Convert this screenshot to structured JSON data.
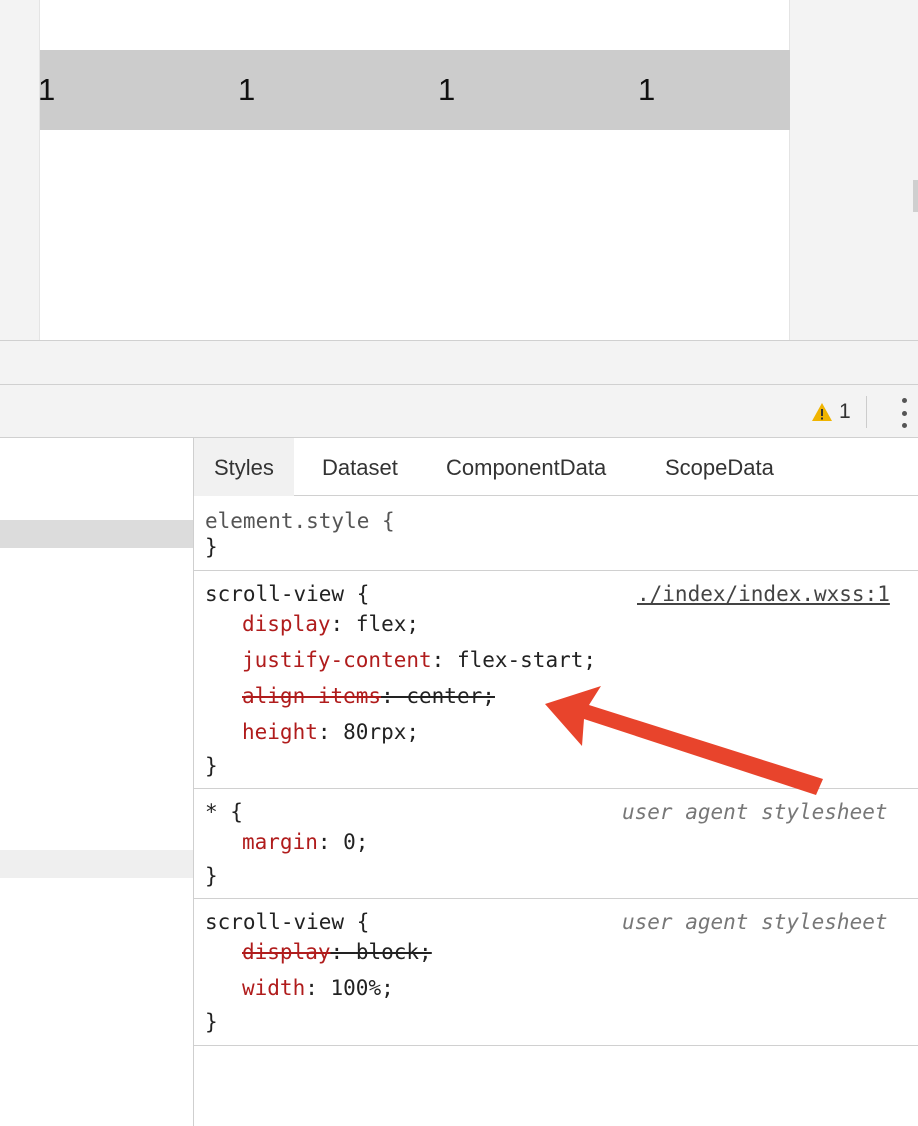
{
  "preview": {
    "row_cells": [
      "1",
      "1",
      "1",
      "1"
    ]
  },
  "toolbar": {
    "warning_count": "1"
  },
  "tabs": [
    {
      "label": "Styles"
    },
    {
      "label": "Dataset"
    },
    {
      "label": "ComponentData"
    },
    {
      "label": "ScopeData"
    }
  ],
  "rules": [
    {
      "selector": "element.style {",
      "close": "}"
    },
    {
      "selector": "scroll-view {",
      "source": "./index/index.wxss:1",
      "decls": [
        {
          "prop": "display",
          "value": "flex;"
        },
        {
          "prop": "justify-content",
          "value": "flex-start;"
        },
        {
          "prop": "align-items",
          "value": "center;"
        },
        {
          "prop": "height",
          "value": "80rpx;"
        }
      ],
      "close": "}"
    },
    {
      "selector": "* {",
      "source": "user agent stylesheet",
      "decls": [
        {
          "prop": "margin",
          "value": "0;"
        }
      ],
      "close": "}"
    },
    {
      "selector": "scroll-view {",
      "source": "user agent stylesheet",
      "decls": [
        {
          "prop": "display",
          "value": "block;"
        },
        {
          "prop": "width",
          "value": "100%;"
        }
      ],
      "close": "}"
    }
  ],
  "colors": {
    "property": "#b01c1c",
    "arrow": "#e8442c",
    "warning": "#f0b400"
  }
}
